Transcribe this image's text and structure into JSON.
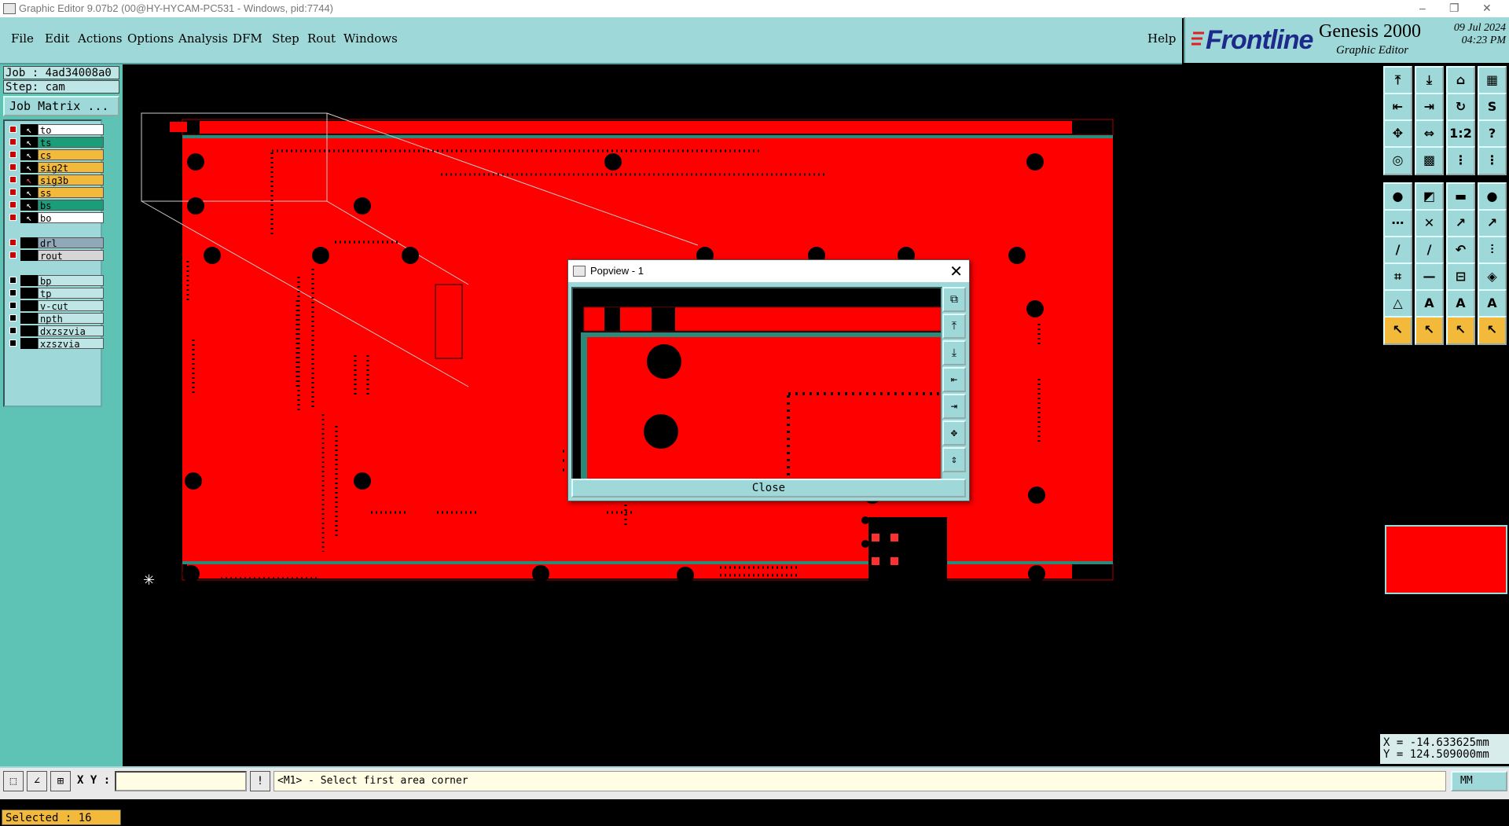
{
  "window": {
    "title": "Graphic Editor 9.07b2 (00@HY-HYCAM-PC531 - Windows, pid:7744)",
    "controls": [
      "–",
      "❐",
      "✕"
    ]
  },
  "menu": {
    "items": [
      "File",
      "Edit",
      "Actions",
      "Options",
      "Analysis",
      "DFM",
      "Step",
      "Rout",
      "Windows"
    ],
    "help": "Help"
  },
  "brand": {
    "logo": "Frontline",
    "product": "Genesis 2000",
    "subtitle": "Graphic Editor",
    "date": "09 Jul 2024",
    "time": "04:23 PM"
  },
  "left": {
    "job": "Job : 4ad34008a0",
    "step": "Step: cam",
    "job_matrix": "Job Matrix ...",
    "layers": [
      {
        "name": "to",
        "color": "#ffffff",
        "active": true,
        "arrow": true
      },
      {
        "name": "ts",
        "color": "#1a9e7a",
        "active": true,
        "arrow": true
      },
      {
        "name": "cs",
        "color": "#f2b93b",
        "active": true,
        "arrow": true
      },
      {
        "name": "sig2t",
        "color": "#f2b93b",
        "active": true,
        "arrow": true
      },
      {
        "name": "sig3b",
        "color": "#f2b93b",
        "active": true,
        "arrow": true,
        "selected": true
      },
      {
        "name": "ss",
        "color": "#f2b93b",
        "active": true,
        "arrow": true
      },
      {
        "name": "bs",
        "color": "#1a9e7a",
        "active": true,
        "arrow": true
      },
      {
        "name": "bo",
        "color": "#ffffff",
        "active": true,
        "arrow": true
      },
      {
        "name": "drl",
        "color": "#8fa9b8",
        "active": true,
        "arrow": false
      },
      {
        "name": "rout",
        "color": "#d6d6d6",
        "active": true,
        "arrow": false
      },
      {
        "name": "bp",
        "color": "#bfe6e6",
        "active": false,
        "arrow": false
      },
      {
        "name": "tp",
        "color": "#bfe6e6",
        "active": false,
        "arrow": false
      },
      {
        "name": "v-cut",
        "color": "#bfe6e6",
        "active": false,
        "arrow": false
      },
      {
        "name": "npth",
        "color": "#bfe6e6",
        "active": false,
        "arrow": false
      },
      {
        "name": "dxzszvia",
        "color": "#bfe6e6",
        "active": false,
        "arrow": false
      },
      {
        "name": "xzszvia",
        "color": "#bfe6e6",
        "active": false,
        "arrow": false
      }
    ],
    "selected": "Selected : 16"
  },
  "popview": {
    "title": "Popview - 1",
    "close_label": "Close"
  },
  "right": {
    "toolbar_rows": [
      [
        "⤒",
        "⤓",
        "⌂",
        "▦"
      ],
      [
        "⇤",
        "⇥",
        "↻",
        "S"
      ],
      [
        "✥",
        "⇔",
        "1:2",
        "?"
      ],
      [
        "◎",
        "▩",
        "⋮",
        "⋮"
      ],
      [
        "●",
        "◩",
        "▬",
        "●"
      ],
      [
        "⋯",
        "✕",
        "↗",
        "↗"
      ],
      [
        "∕",
        "∕",
        "↶",
        "⫶"
      ],
      [
        "⌗",
        "—",
        "⊟",
        "◈"
      ],
      [
        "△",
        "A",
        "A",
        "A"
      ],
      [
        "↖",
        "↖",
        "↖",
        "↖"
      ]
    ],
    "coord_x": "X = -14.633625mm",
    "coord_y": "Y = 124.509000mm"
  },
  "status": {
    "xy_label": "X Y :",
    "xy_value": "",
    "message": "<M1> - Select first area corner",
    "units": "MM"
  }
}
